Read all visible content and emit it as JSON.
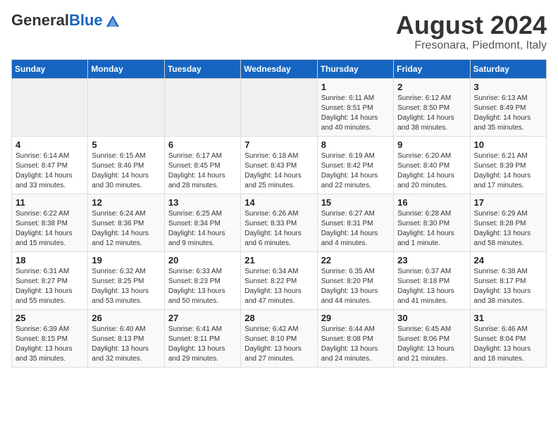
{
  "logo": {
    "general": "General",
    "blue": "Blue"
  },
  "title": "August 2024",
  "subtitle": "Fresonara, Piedmont, Italy",
  "days_of_week": [
    "Sunday",
    "Monday",
    "Tuesday",
    "Wednesday",
    "Thursday",
    "Friday",
    "Saturday"
  ],
  "weeks": [
    [
      {
        "day": "",
        "info": ""
      },
      {
        "day": "",
        "info": ""
      },
      {
        "day": "",
        "info": ""
      },
      {
        "day": "",
        "info": ""
      },
      {
        "day": "1",
        "info": "Sunrise: 6:11 AM\nSunset: 8:51 PM\nDaylight: 14 hours and 40 minutes."
      },
      {
        "day": "2",
        "info": "Sunrise: 6:12 AM\nSunset: 8:50 PM\nDaylight: 14 hours and 38 minutes."
      },
      {
        "day": "3",
        "info": "Sunrise: 6:13 AM\nSunset: 8:49 PM\nDaylight: 14 hours and 35 minutes."
      }
    ],
    [
      {
        "day": "4",
        "info": "Sunrise: 6:14 AM\nSunset: 8:47 PM\nDaylight: 14 hours and 33 minutes."
      },
      {
        "day": "5",
        "info": "Sunrise: 6:15 AM\nSunset: 8:46 PM\nDaylight: 14 hours and 30 minutes."
      },
      {
        "day": "6",
        "info": "Sunrise: 6:17 AM\nSunset: 8:45 PM\nDaylight: 14 hours and 28 minutes."
      },
      {
        "day": "7",
        "info": "Sunrise: 6:18 AM\nSunset: 8:43 PM\nDaylight: 14 hours and 25 minutes."
      },
      {
        "day": "8",
        "info": "Sunrise: 6:19 AM\nSunset: 8:42 PM\nDaylight: 14 hours and 22 minutes."
      },
      {
        "day": "9",
        "info": "Sunrise: 6:20 AM\nSunset: 8:40 PM\nDaylight: 14 hours and 20 minutes."
      },
      {
        "day": "10",
        "info": "Sunrise: 6:21 AM\nSunset: 8:39 PM\nDaylight: 14 hours and 17 minutes."
      }
    ],
    [
      {
        "day": "11",
        "info": "Sunrise: 6:22 AM\nSunset: 8:38 PM\nDaylight: 14 hours and 15 minutes."
      },
      {
        "day": "12",
        "info": "Sunrise: 6:24 AM\nSunset: 8:36 PM\nDaylight: 14 hours and 12 minutes."
      },
      {
        "day": "13",
        "info": "Sunrise: 6:25 AM\nSunset: 8:34 PM\nDaylight: 14 hours and 9 minutes."
      },
      {
        "day": "14",
        "info": "Sunrise: 6:26 AM\nSunset: 8:33 PM\nDaylight: 14 hours and 6 minutes."
      },
      {
        "day": "15",
        "info": "Sunrise: 6:27 AM\nSunset: 8:31 PM\nDaylight: 14 hours and 4 minutes."
      },
      {
        "day": "16",
        "info": "Sunrise: 6:28 AM\nSunset: 8:30 PM\nDaylight: 14 hours and 1 minute."
      },
      {
        "day": "17",
        "info": "Sunrise: 6:29 AM\nSunset: 8:28 PM\nDaylight: 13 hours and 58 minutes."
      }
    ],
    [
      {
        "day": "18",
        "info": "Sunrise: 6:31 AM\nSunset: 8:27 PM\nDaylight: 13 hours and 55 minutes."
      },
      {
        "day": "19",
        "info": "Sunrise: 6:32 AM\nSunset: 8:25 PM\nDaylight: 13 hours and 53 minutes."
      },
      {
        "day": "20",
        "info": "Sunrise: 6:33 AM\nSunset: 8:23 PM\nDaylight: 13 hours and 50 minutes."
      },
      {
        "day": "21",
        "info": "Sunrise: 6:34 AM\nSunset: 8:22 PM\nDaylight: 13 hours and 47 minutes."
      },
      {
        "day": "22",
        "info": "Sunrise: 6:35 AM\nSunset: 8:20 PM\nDaylight: 13 hours and 44 minutes."
      },
      {
        "day": "23",
        "info": "Sunrise: 6:37 AM\nSunset: 8:18 PM\nDaylight: 13 hours and 41 minutes."
      },
      {
        "day": "24",
        "info": "Sunrise: 6:38 AM\nSunset: 8:17 PM\nDaylight: 13 hours and 38 minutes."
      }
    ],
    [
      {
        "day": "25",
        "info": "Sunrise: 6:39 AM\nSunset: 8:15 PM\nDaylight: 13 hours and 35 minutes."
      },
      {
        "day": "26",
        "info": "Sunrise: 6:40 AM\nSunset: 8:13 PM\nDaylight: 13 hours and 32 minutes."
      },
      {
        "day": "27",
        "info": "Sunrise: 6:41 AM\nSunset: 8:11 PM\nDaylight: 13 hours and 29 minutes."
      },
      {
        "day": "28",
        "info": "Sunrise: 6:42 AM\nSunset: 8:10 PM\nDaylight: 13 hours and 27 minutes."
      },
      {
        "day": "29",
        "info": "Sunrise: 6:44 AM\nSunset: 8:08 PM\nDaylight: 13 hours and 24 minutes."
      },
      {
        "day": "30",
        "info": "Sunrise: 6:45 AM\nSunset: 8:06 PM\nDaylight: 13 hours and 21 minutes."
      },
      {
        "day": "31",
        "info": "Sunrise: 6:46 AM\nSunset: 8:04 PM\nDaylight: 13 hours and 18 minutes."
      }
    ]
  ]
}
